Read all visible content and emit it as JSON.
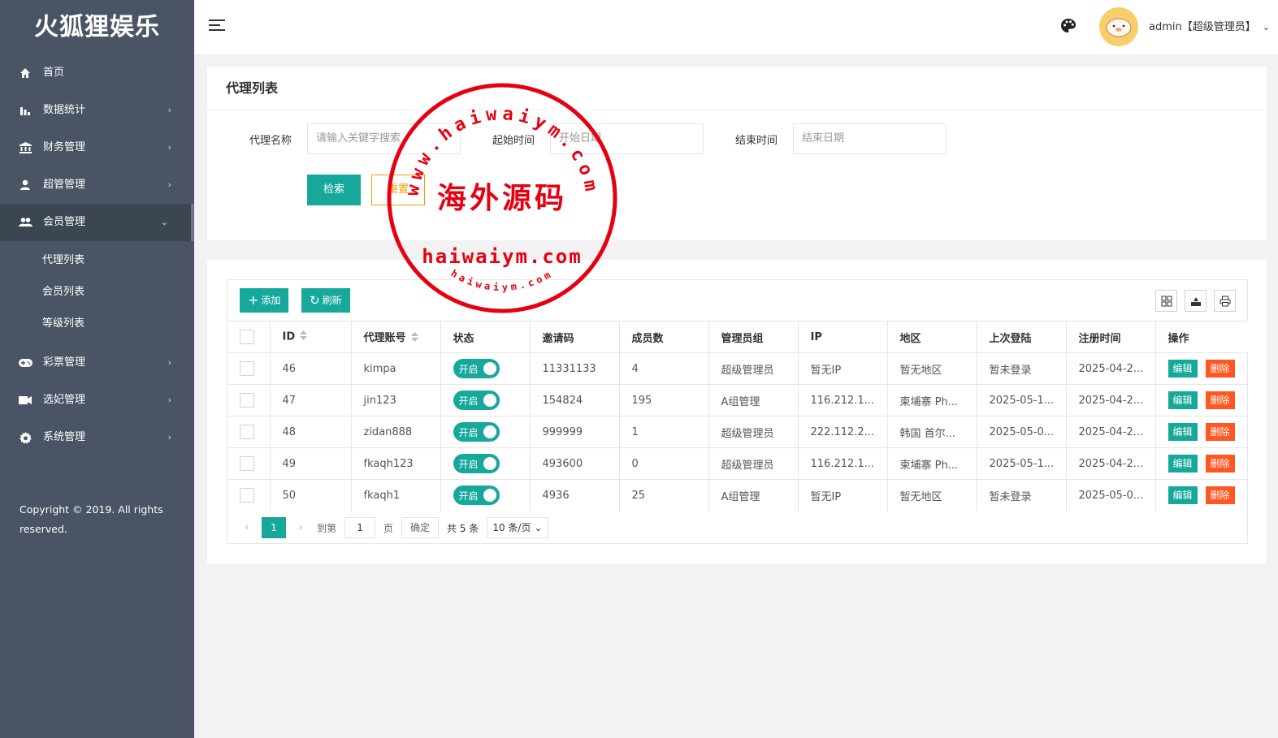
{
  "app": {
    "logo": "火狐狸娱乐"
  },
  "sidebar": {
    "items": [
      {
        "label": "首页",
        "icon": "home-icon",
        "arrow": ""
      },
      {
        "label": "数据统计",
        "icon": "bar-chart-icon",
        "arrow": "›"
      },
      {
        "label": "财务管理",
        "icon": "bank-icon",
        "arrow": "›"
      },
      {
        "label": "超管管理",
        "icon": "user-icon",
        "arrow": "›"
      },
      {
        "label": "会员管理",
        "icon": "users-icon",
        "arrow": "⌄"
      },
      {
        "label": "彩票管理",
        "icon": "gamepad-icon",
        "arrow": "›"
      },
      {
        "label": "选妃管理",
        "icon": "video-icon",
        "arrow": "›"
      },
      {
        "label": "系统管理",
        "icon": "gear-icon",
        "arrow": "›"
      }
    ],
    "sub_items": [
      "代理列表",
      "会员列表",
      "等级列表"
    ],
    "copyright": "Copyright © 2019. All rights reserved."
  },
  "header": {
    "user": "admin【超级管理员】",
    "user_arrow": "⌄"
  },
  "search_card": {
    "title": "代理列表",
    "name_label": "代理名称",
    "name_placeholder": "请输入关键字搜索",
    "start_label": "起始时间",
    "start_placeholder": "开始日期",
    "end_label": "结束时间",
    "end_placeholder": "结束日期",
    "search_btn": "检索",
    "reset_btn": "重置"
  },
  "table_card": {
    "add_btn": "添加",
    "refresh_btn": "刷新",
    "columns": [
      "ID",
      "代理账号",
      "状态",
      "邀请码",
      "成员数",
      "管理员组",
      "IP",
      "地区",
      "上次登陆",
      "注册时间",
      "操作"
    ],
    "rows": [
      {
        "id": "46",
        "account": "kimpa",
        "status": "开启",
        "code": "11331133",
        "members": "4",
        "group": "超级管理员",
        "ip": "暂无IP",
        "region": "暂无地区",
        "last_login": "暂未登录",
        "reg_time": "2025-04-2..."
      },
      {
        "id": "47",
        "account": "jin123",
        "status": "开启",
        "code": "154824",
        "members": "195",
        "group": "A组管理",
        "ip": "116.212.1...",
        "region": "柬埔寨 Ph...",
        "last_login": "2025-05-1...",
        "reg_time": "2025-04-2..."
      },
      {
        "id": "48",
        "account": "zidan888",
        "status": "开启",
        "code": "999999",
        "members": "1",
        "group": "超级管理员",
        "ip": "222.112.2...",
        "region": "韩国 首尔...",
        "last_login": "2025-05-0...",
        "reg_time": "2025-04-2..."
      },
      {
        "id": "49",
        "account": "fkaqh123",
        "status": "开启",
        "code": "493600",
        "members": "0",
        "group": "超级管理员",
        "ip": "116.212.1...",
        "region": "柬埔寨 Ph...",
        "last_login": "2025-05-1...",
        "reg_time": "2025-04-2..."
      },
      {
        "id": "50",
        "account": "fkaqh1",
        "status": "开启",
        "code": "4936",
        "members": "25",
        "group": "A组管理",
        "ip": "暂无IP",
        "region": "暂无地区",
        "last_login": "暂未登录",
        "reg_time": "2025-05-0..."
      }
    ],
    "edit_btn": "编辑",
    "delete_btn": "删除"
  },
  "pager": {
    "current": "1",
    "goto_label": "到第",
    "goto_value": "1",
    "page_label": "页",
    "confirm": "确定",
    "total": "共 5 条",
    "per_page": "10 条/页"
  },
  "watermark": {
    "top_arc": "www.haiwaiym.com",
    "center": "海外源码",
    "domain": "haiwaiym.com",
    "bottom_arc": "haiwaiym.com"
  },
  "colors": {
    "sidebar_bg": "#4a5464",
    "accent": "#16a89a",
    "danger": "#ff5722",
    "warning": "#f0a000",
    "stamp": "#e60012"
  }
}
